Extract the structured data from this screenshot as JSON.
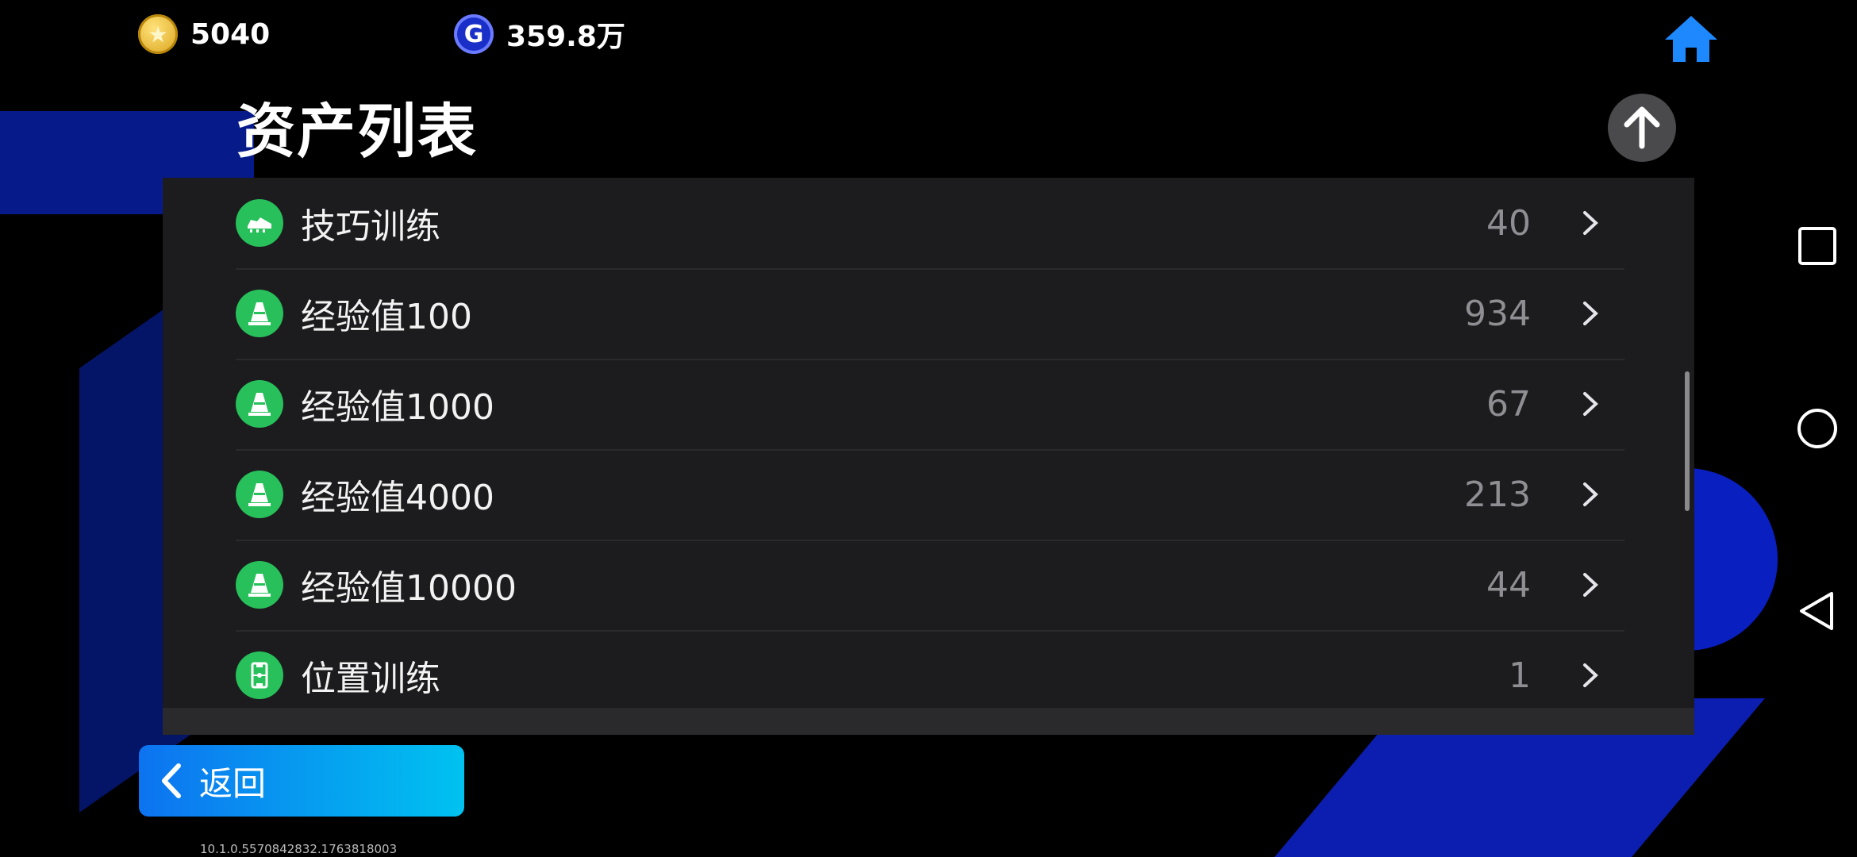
{
  "currencies": {
    "coins": {
      "icon": "coin-star-icon",
      "value": "5040"
    },
    "gems": {
      "icon": "g-gem-icon",
      "value": "359.8万"
    }
  },
  "page": {
    "title": "资产列表"
  },
  "assets": [
    {
      "icon": "boot-icon",
      "label": "技巧训练",
      "count": "40"
    },
    {
      "icon": "cone-icon",
      "label": "经验值100",
      "count": "934"
    },
    {
      "icon": "cone-icon",
      "label": "经验值1000",
      "count": "67"
    },
    {
      "icon": "cone-icon",
      "label": "经验值4000",
      "count": "213"
    },
    {
      "icon": "cone-icon",
      "label": "经验值10000",
      "count": "44"
    },
    {
      "icon": "pitch-icon",
      "label": "位置训练",
      "count": "1"
    }
  ],
  "back_button": {
    "label": "返回"
  },
  "version": "10.1.0.5570842832.1763818003",
  "colors": {
    "accent_blue": "#0d73f0",
    "accent_cyan": "#00c2f0",
    "icon_green": "#27c05a",
    "panel_bg": "#1c1c1e",
    "home_blue": "#1e88ff"
  }
}
